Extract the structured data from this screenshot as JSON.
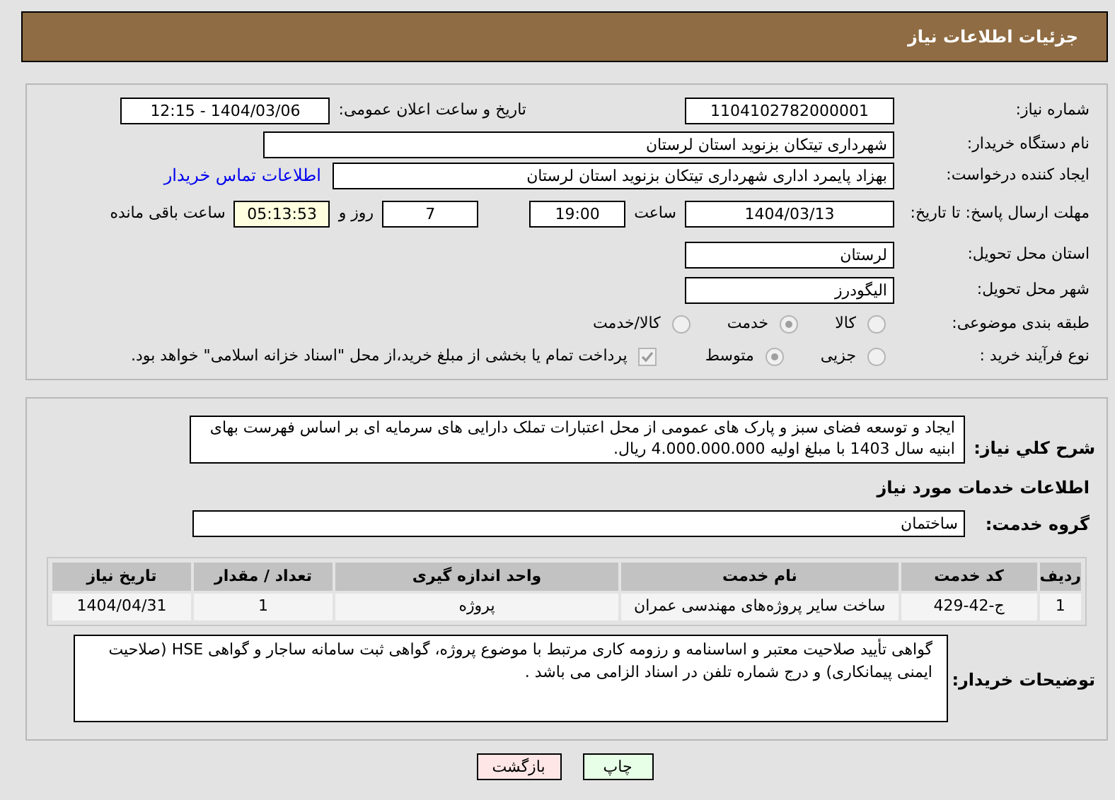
{
  "header": {
    "title": "جزئیات اطلاعات نیاز"
  },
  "details": {
    "need_number": {
      "label": "شماره نیاز:",
      "value": "1104102782000001"
    },
    "announce": {
      "label": "تاریخ و ساعت اعلان عمومی:",
      "value": "1404/03/06 - 12:15"
    },
    "buyer": {
      "label": "نام دستگاه خریدار:",
      "value": "شهرداری تیتکان بزنوید استان لرستان"
    },
    "requester": {
      "label": "ایجاد کننده درخواست:",
      "value": "بهزاد پایمرد اداری شهرداری تیتکان بزنوید استان لرستان",
      "link": "اطلاعات تماس خریدار"
    },
    "deadline": {
      "label": "مهلت ارسال پاسخ: تا تاریخ:",
      "date": "1404/03/13",
      "time_label": "ساعت",
      "time": "19:00",
      "days": "7",
      "days_label": "روز و",
      "remaining": "05:13:53",
      "remaining_label": "ساعت باقی مانده"
    },
    "province": {
      "label": "استان محل تحویل:",
      "value": "لرستان"
    },
    "city": {
      "label": "شهر محل تحویل:",
      "value": "الیگودرز"
    },
    "category": {
      "label": "طبقه بندی موضوعی:",
      "options": [
        {
          "label": "کالا",
          "selected": false
        },
        {
          "label": "خدمت",
          "selected": true
        },
        {
          "label": "کالا/خدمت",
          "selected": false
        }
      ]
    },
    "process": {
      "label": "نوع فرآیند خرید :",
      "options": [
        {
          "label": "جزیی",
          "selected": false
        },
        {
          "label": "متوسط",
          "selected": true
        }
      ],
      "payment": {
        "label": "پرداخت تمام یا بخشی از مبلغ خرید،از محل \"اسناد خزانه اسلامی\" خواهد بود.",
        "checked": true
      }
    }
  },
  "services": {
    "description": {
      "label": "شرح کلي نياز:",
      "value": "ایجاد و توسعه فضای سبز و پارک های عمومی از محل اعتبارات تملک دارایی های سرمایه ای بر اساس فهرست بهای ابنیه سال 1403 با مبلغ اولیه 4.000.000.000 ریال."
    },
    "heading": "اطلاعات خدمات مورد نیاز",
    "group": {
      "label": "گروه خدمت:",
      "value": "ساختمان"
    },
    "table": {
      "columns": [
        "ردیف",
        "کد خدمت",
        "نام خدمت",
        "واحد اندازه گیری",
        "تعداد / مقدار",
        "تاریخ نیاز"
      ],
      "rows": [
        [
          "1",
          "ج-42-429",
          "ساخت سایر پروژه‌های مهندسی عمران",
          "پروژه",
          "1",
          "1404/04/31"
        ]
      ]
    },
    "notes": {
      "label": "توضیحات خریدار:",
      "value": "گواهی تأیید صلاحیت معتبر و اساسنامه و رزومه کاری مرتبط با موضوع پروژه، گواهی ثبت سامانه ساجار و گواهی HSE (صلاحیت ایمنی پیمانکاری) و درج شماره تلفن در اسناد الزامی می باشد ."
    }
  },
  "buttons": [
    {
      "label": "چاپ",
      "kind": "print"
    },
    {
      "label": "بازگشت",
      "kind": "back"
    }
  ]
}
